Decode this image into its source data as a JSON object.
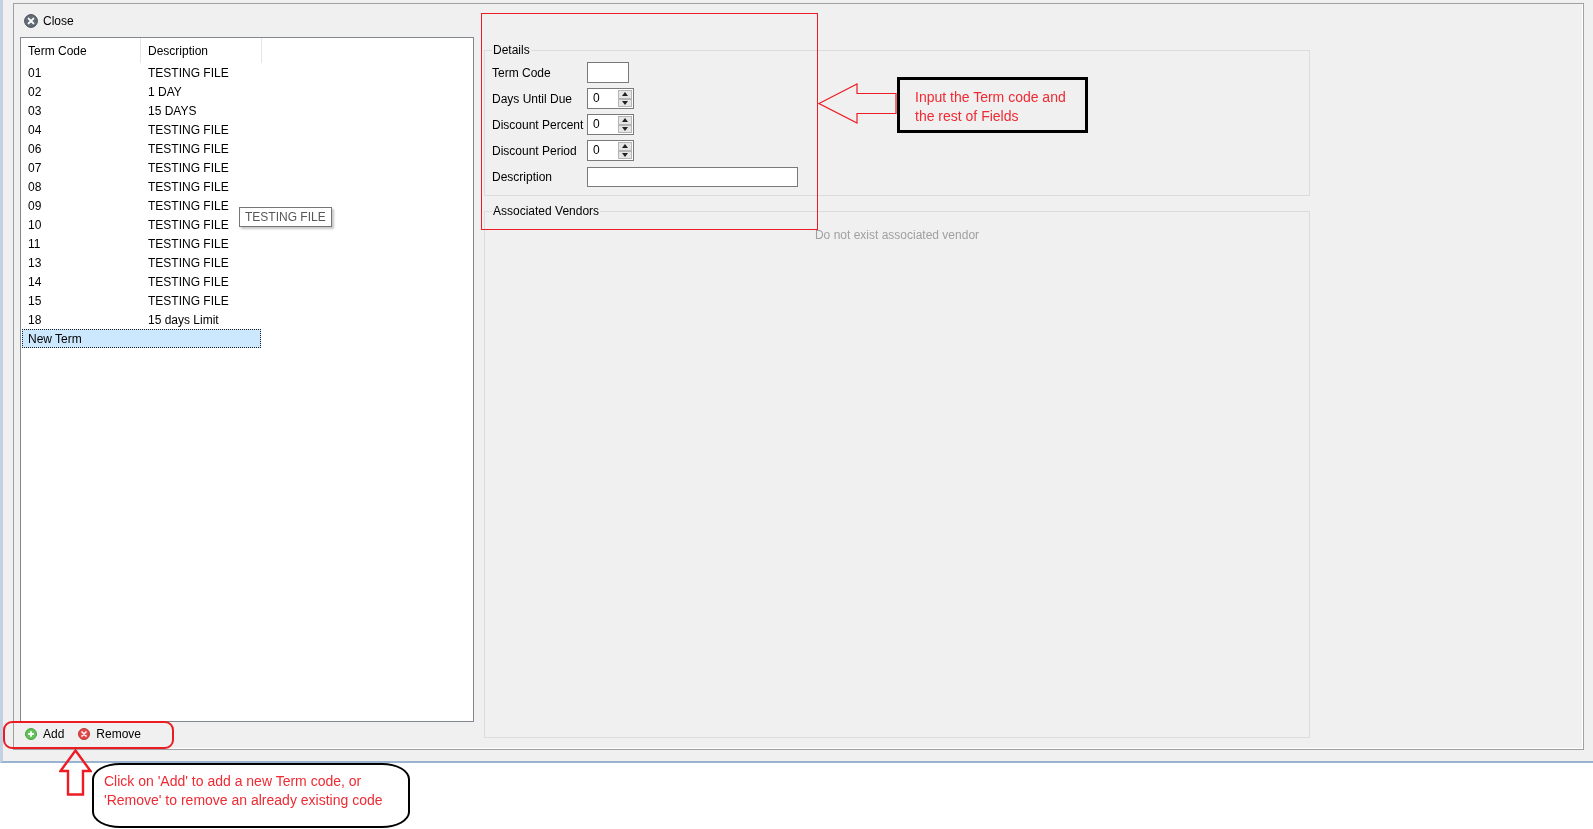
{
  "toolbar": {
    "close_button": {
      "label": "Close"
    }
  },
  "term_list": {
    "columns": [
      "Term Code",
      "Description"
    ],
    "rows": [
      {
        "cells": [
          "01",
          "TESTING FILE"
        ],
        "selected": false
      },
      {
        "cells": [
          "02",
          "1 DAY"
        ],
        "selected": false
      },
      {
        "cells": [
          "03",
          "15 DAYS"
        ],
        "selected": false
      },
      {
        "cells": [
          "04",
          "TESTING FILE"
        ],
        "selected": false
      },
      {
        "cells": [
          "06",
          "TESTING FILE"
        ],
        "selected": false
      },
      {
        "cells": [
          "07",
          "TESTING FILE"
        ],
        "selected": false
      },
      {
        "cells": [
          "08",
          "TESTING FILE"
        ],
        "selected": false
      },
      {
        "cells": [
          "09",
          "TESTING FILE"
        ],
        "selected": false
      },
      {
        "cells": [
          "10",
          "TESTING FILE"
        ],
        "selected": false
      },
      {
        "cells": [
          "11",
          "TESTING FILE"
        ],
        "selected": false
      },
      {
        "cells": [
          "13",
          "TESTING FILE"
        ],
        "selected": false
      },
      {
        "cells": [
          "14",
          "TESTING FILE"
        ],
        "selected": false
      },
      {
        "cells": [
          "15",
          "TESTING FILE"
        ],
        "selected": false
      },
      {
        "cells": [
          "18",
          "15 days Limit"
        ],
        "selected": false
      },
      {
        "cells": [
          "New Term"
        ],
        "selected": true
      }
    ]
  },
  "tooltip": {
    "text": "TESTING FILE"
  },
  "list_buttons": [
    {
      "kind": "add",
      "label": "Add"
    },
    {
      "kind": "remove",
      "label": "Remove"
    }
  ],
  "details": {
    "title": "Details",
    "fields": [
      {
        "kind": "short",
        "label": "Term Code"
      },
      {
        "kind": "spin",
        "label": "Days Until Due",
        "value": "0"
      },
      {
        "kind": "spin",
        "label": "Discount Percent",
        "value": "0"
      },
      {
        "kind": "spin",
        "label": "Discount Period",
        "value": "0"
      },
      {
        "kind": "wide",
        "label": "Description"
      }
    ]
  },
  "associated_vendors": {
    "title": "Associated Vendors",
    "empty_message": "Do not exist associated vendor"
  },
  "annotations": [
    {
      "kind": "box",
      "text": "Input the Term code and the rest of Fields"
    },
    {
      "kind": "bubble",
      "text": "Click on 'Add' to add a new Term code, or 'Remove' to remove an already existing code"
    }
  ]
}
